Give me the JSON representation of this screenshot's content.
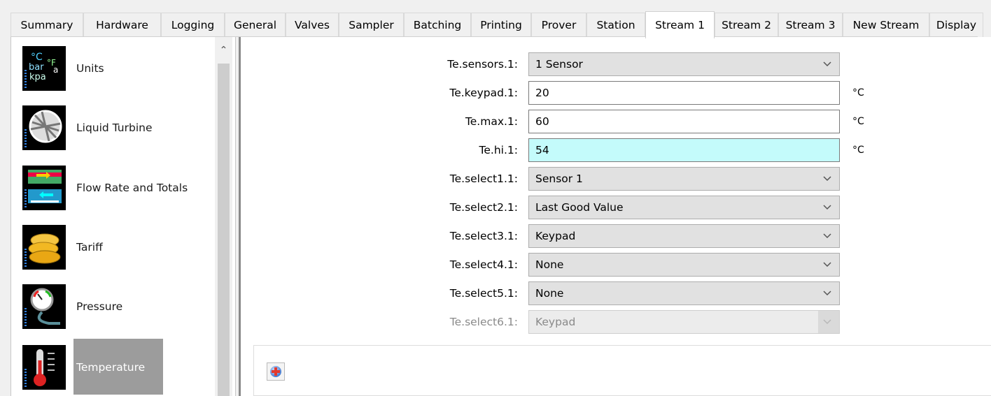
{
  "tabs": [
    {
      "label": "Summary",
      "active": false
    },
    {
      "label": "Hardware",
      "active": false
    },
    {
      "label": "Logging",
      "active": false
    },
    {
      "label": "General",
      "active": false
    },
    {
      "label": "Valves",
      "active": false
    },
    {
      "label": "Sampler",
      "active": false
    },
    {
      "label": "Batching",
      "active": false
    },
    {
      "label": "Printing",
      "active": false
    },
    {
      "label": "Prover",
      "active": false
    },
    {
      "label": "Station",
      "active": false
    },
    {
      "label": "Stream 1",
      "active": true
    },
    {
      "label": "Stream 2",
      "active": false
    },
    {
      "label": "Stream 3",
      "active": false
    },
    {
      "label": "New Stream",
      "active": false
    },
    {
      "label": "Display",
      "active": false
    }
  ],
  "categories": [
    {
      "label": "Units",
      "icon": "units-icon",
      "icon_text": [
        "°C",
        "bar",
        "°F",
        "a",
        "kpa"
      ]
    },
    {
      "label": "Liquid Turbine",
      "icon": "turbine-icon"
    },
    {
      "label": "Flow Rate and Totals",
      "icon": "flow-rate-icon"
    },
    {
      "label": "Tariff",
      "icon": "coins-icon"
    },
    {
      "label": "Pressure",
      "icon": "pressure-gauge-icon"
    },
    {
      "label": "Temperature",
      "icon": "thermometer-icon",
      "selected": true
    }
  ],
  "form": {
    "rows": [
      {
        "label": "Te.sensors.1:",
        "type": "select",
        "value": "1 Sensor"
      },
      {
        "label": "Te.keypad.1:",
        "type": "text",
        "value": "20",
        "unit": "°C"
      },
      {
        "label": "Te.max.1:",
        "type": "text",
        "value": "60",
        "unit": "°C"
      },
      {
        "label": "Te.hi.1:",
        "type": "text",
        "value": "54",
        "unit": "°C",
        "focused": true
      },
      {
        "label": "Te.select1.1:",
        "type": "select",
        "value": "Sensor 1"
      },
      {
        "label": "Te.select2.1:",
        "type": "select",
        "value": "Last Good Value"
      },
      {
        "label": "Te.select3.1:",
        "type": "select",
        "value": "Keypad"
      },
      {
        "label": "Te.select4.1:",
        "type": "select",
        "value": "None"
      },
      {
        "label": "Te.select5.1:",
        "type": "select",
        "value": "None"
      },
      {
        "label": "Te.select6.1:",
        "type": "select",
        "value": "Keypad",
        "disabled": true
      }
    ]
  },
  "add_button": {
    "icon": "add-plus-icon"
  },
  "colors": {
    "focused_field": "#c4fbfb",
    "selected_category": "#9c9c9c",
    "accent_blue": "#2f7fe0"
  }
}
